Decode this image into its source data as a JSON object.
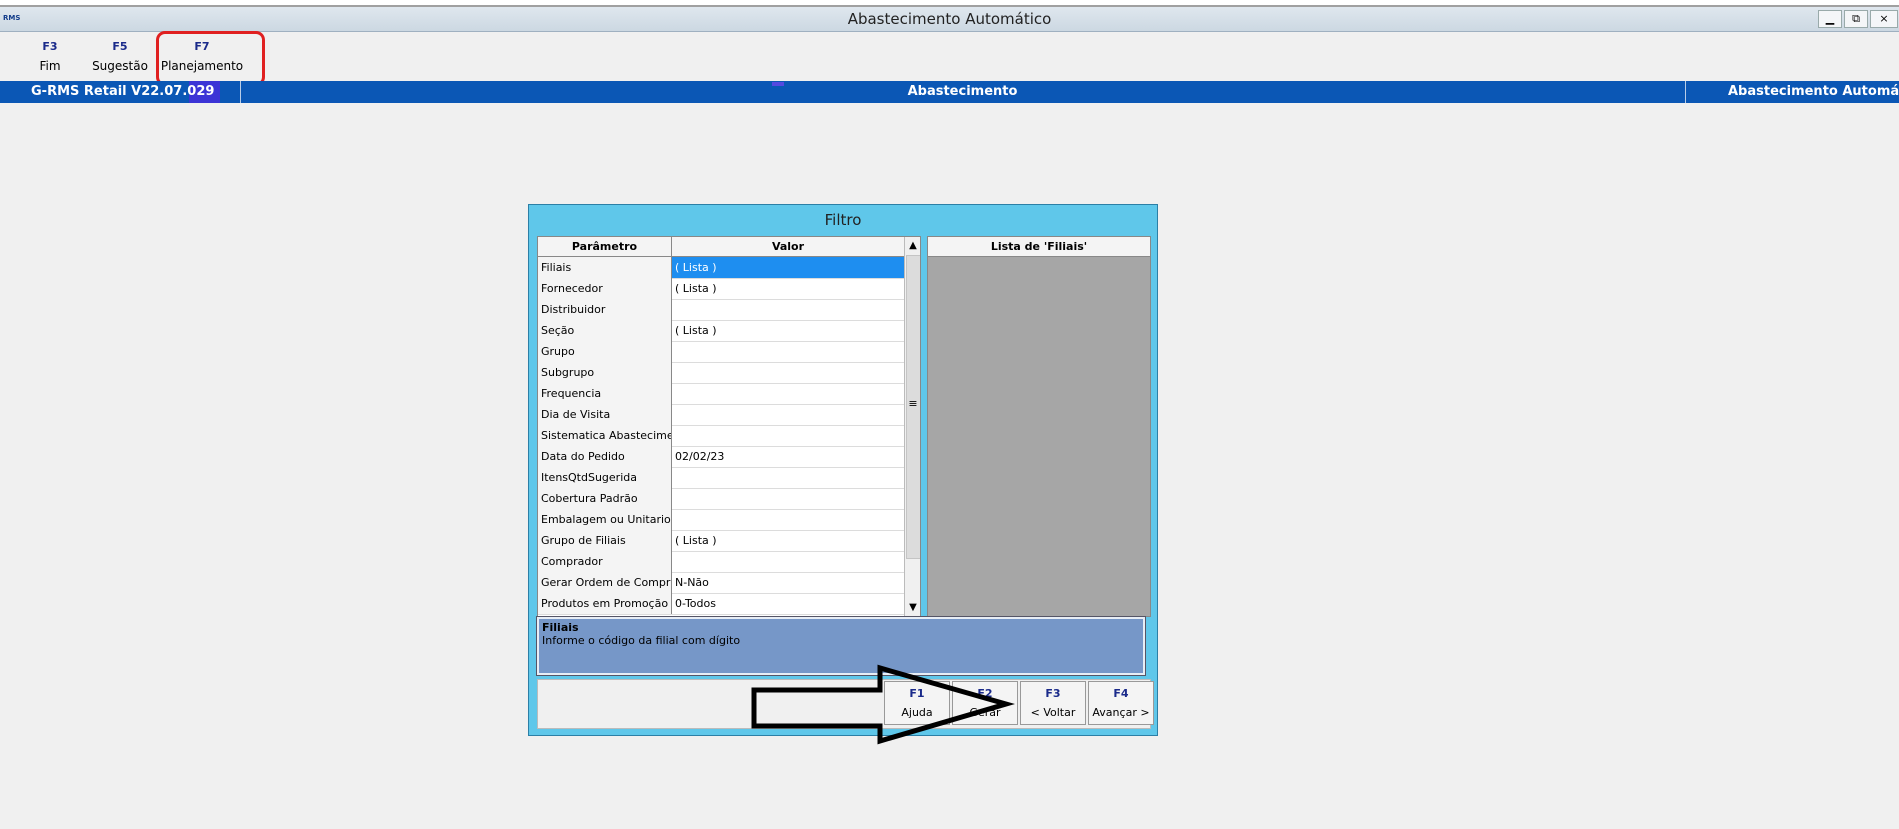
{
  "window": {
    "logo": "RMS",
    "title": "Abastecimento Automático",
    "controls": {
      "minimize": "▁",
      "restore": "⧉",
      "close": "×"
    }
  },
  "toolbar": [
    {
      "key": "F3",
      "label": "Fim"
    },
    {
      "key": "F5",
      "label": "Sugestão"
    },
    {
      "key": "F7",
      "label": "Planejamento"
    }
  ],
  "statusbar": {
    "version": "G-RMS Retail V22.07.029",
    "module": "Abastecimento",
    "screen": "Abastecimento Automático",
    "color": "#0b57b5"
  },
  "dialog": {
    "title": "Filtro",
    "grid": {
      "col_param": "Parâmetro",
      "col_value": "Valor",
      "rows": [
        {
          "param": "Filiais",
          "value": "( Lista )",
          "selected": true
        },
        {
          "param": "Fornecedor",
          "value": "( Lista )"
        },
        {
          "param": "Distribuidor",
          "value": ""
        },
        {
          "param": "Seção",
          "value": "( Lista )"
        },
        {
          "param": "Grupo",
          "value": ""
        },
        {
          "param": "Subgrupo",
          "value": ""
        },
        {
          "param": "Frequencia",
          "value": ""
        },
        {
          "param": "Dia de Visita",
          "value": ""
        },
        {
          "param": "Sistematica Abastecimento",
          "value": ""
        },
        {
          "param": "Data do Pedido",
          "value": "02/02/23"
        },
        {
          "param": "ItensQtdSugerida",
          "value": ""
        },
        {
          "param": "Cobertura Padrão",
          "value": ""
        },
        {
          "param": "Embalagem ou Unitario",
          "value": ""
        },
        {
          "param": "Grupo de Filiais",
          "value": "( Lista )"
        },
        {
          "param": "Comprador",
          "value": ""
        },
        {
          "param": "Gerar Ordem de Compra",
          "value": "N-Não"
        },
        {
          "param": "Produtos em Promoção",
          "value": "0-Todos"
        }
      ]
    },
    "list_panel_title": "Lista de 'Filiais'",
    "help": {
      "title": "Filiais",
      "text": "Informe o código da filial com dígito"
    },
    "buttons": [
      {
        "key": "F1",
        "label": "Ajuda"
      },
      {
        "key": "F2",
        "label": "Gerar"
      },
      {
        "key": "F3",
        "label": "< Voltar"
      },
      {
        "key": "F4",
        "label": "Avançar >"
      }
    ]
  }
}
